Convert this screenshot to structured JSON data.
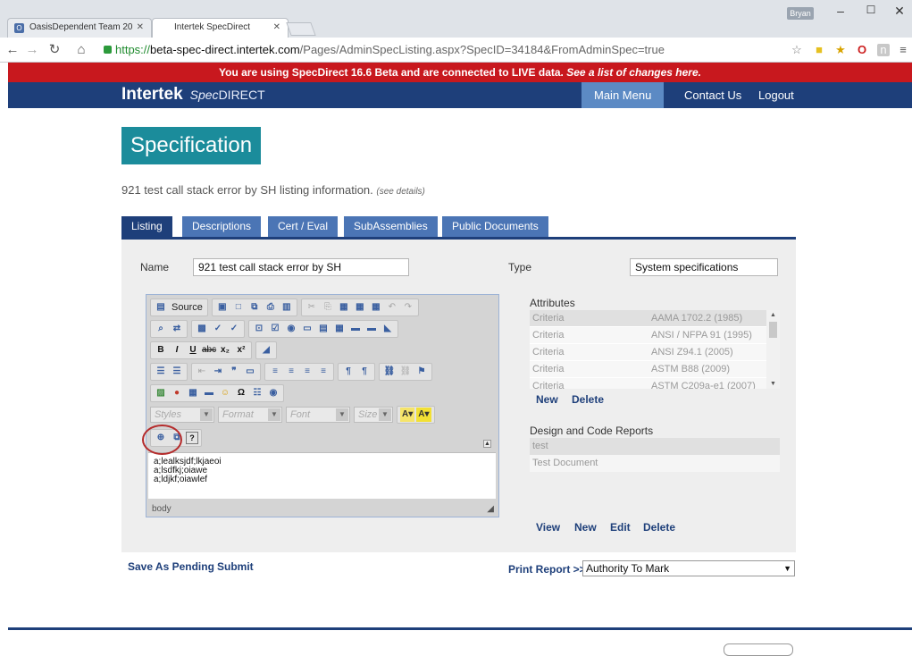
{
  "browser": {
    "tabs": [
      {
        "label": "OasisDependent Team 20",
        "favicon": "O"
      },
      {
        "label": "Intertek SpecDirect",
        "favicon": ""
      }
    ],
    "user_badge": "Bryan",
    "url": {
      "scheme": "https://",
      "host": "beta-spec-direct.intertek.com",
      "path": "/Pages/AdminSpecListing.aspx?SpecID=34184&FromAdminSpec=true"
    }
  },
  "banner": {
    "text": "You are using SpecDirect 16.6 Beta and are connected to LIVE data.",
    "link": "See a list of changes here."
  },
  "header": {
    "brand": "Intertek",
    "product_spec": "Spec",
    "product_direct": "DIRECT",
    "nav": [
      "Main Menu",
      "Contact Us",
      "Logout"
    ]
  },
  "page": {
    "title": "Specification",
    "info": "921 test call stack error by SH listing information.",
    "details_link": "(see details)"
  },
  "tabs": [
    "Listing",
    "Descriptions",
    "Cert / Eval",
    "SubAssemblies",
    "Public Documents"
  ],
  "form": {
    "name_label": "Name",
    "name_value": "921 test call stack error by SH",
    "type_label": "Type",
    "type_value": "System specifications"
  },
  "editor": {
    "source_label": "Source",
    "styles_placeholder": "Styles",
    "format_placeholder": "Format",
    "font_placeholder": "Font",
    "size_placeholder": "Size",
    "content_lines": [
      "a;lealksjdf;lkjaeoi",
      "a;lsdfkj;oiawe",
      "a;ldjkf;oiawlef"
    ],
    "status": "body"
  },
  "attributes": {
    "title": "Attributes",
    "rows": [
      {
        "criteria": "Criteria",
        "value": "AAMA 1702.2 (1985)"
      },
      {
        "criteria": "Criteria",
        "value": "ANSI / NFPA 91 (1995)"
      },
      {
        "criteria": "Criteria",
        "value": "ANSI Z94.1 (2005)"
      },
      {
        "criteria": "Criteria",
        "value": "ASTM B88 (2009)"
      },
      {
        "criteria": "Criteria",
        "value": "ASTM C209a-e1 (2007)"
      }
    ],
    "actions": [
      "New",
      "Delete"
    ]
  },
  "design_reports": {
    "title": "Design and Code Reports",
    "rows": [
      "test",
      "Test Document"
    ],
    "actions": [
      "View",
      "New",
      "Edit",
      "Delete"
    ]
  },
  "bottom": {
    "save_pending": "Save As Pending",
    "submit": "Submit",
    "print_label": "Print Report >>",
    "print_value": "Authority To Mark"
  }
}
